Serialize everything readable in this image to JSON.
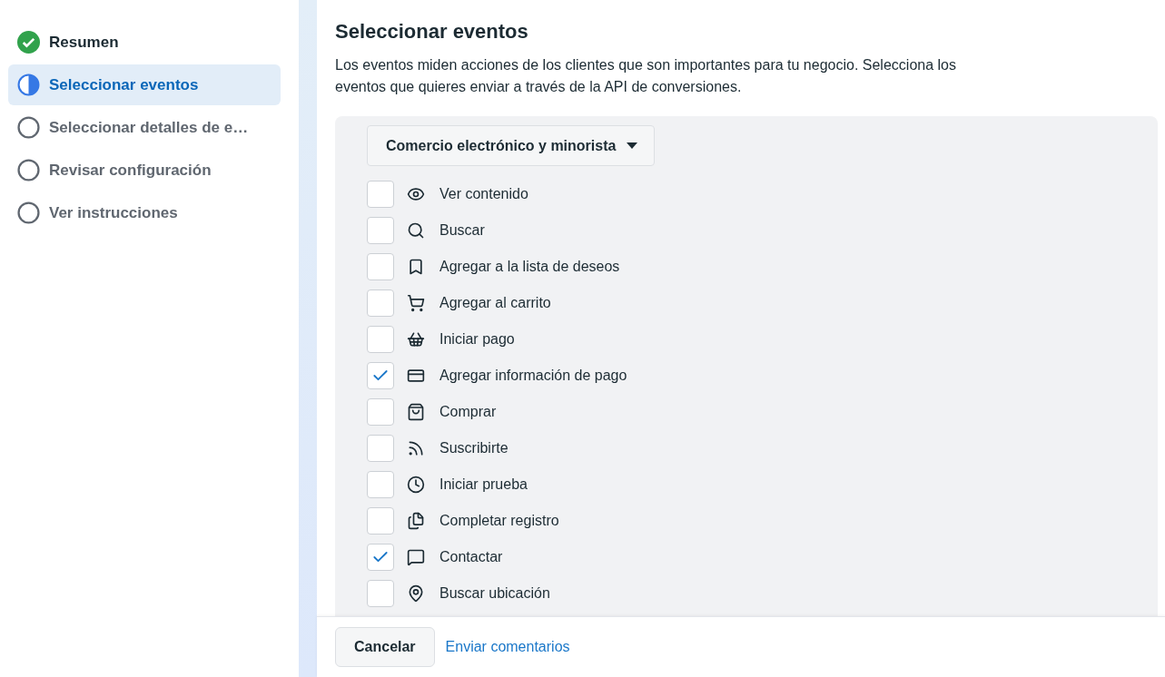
{
  "steps": [
    {
      "label": "Resumen",
      "kind": "complete",
      "selected": false
    },
    {
      "label": "Seleccionar eventos",
      "kind": "current",
      "selected": true
    },
    {
      "label": "Seleccionar detalles de e…",
      "kind": "pending",
      "selected": false
    },
    {
      "label": "Revisar configuración",
      "kind": "pending",
      "selected": false
    },
    {
      "label": "Ver instrucciones",
      "kind": "pending",
      "selected": false
    }
  ],
  "title": "Seleccionar eventos",
  "description": "Los eventos miden acciones de los clientes que son importantes para tu negocio. Selecciona los eventos que quieres enviar a través de la API de conversiones.",
  "category_dropdown": {
    "value": "Comercio electrónico y minorista"
  },
  "events": [
    {
      "label": "Ver contenido",
      "checked": false
    },
    {
      "label": "Buscar",
      "checked": false
    },
    {
      "label": "Agregar a la lista de deseos",
      "checked": false
    },
    {
      "label": "Agregar al carrito",
      "checked": false
    },
    {
      "label": "Iniciar pago",
      "checked": false
    },
    {
      "label": "Agregar información de pago",
      "checked": true
    },
    {
      "label": "Comprar",
      "checked": false
    },
    {
      "label": "Suscribirte",
      "checked": false
    },
    {
      "label": "Iniciar prueba",
      "checked": false
    },
    {
      "label": "Completar registro",
      "checked": false
    },
    {
      "label": "Contactar",
      "checked": true
    },
    {
      "label": "Buscar ubicación",
      "checked": false
    }
  ],
  "footer": {
    "cancel": "Cancelar",
    "feedback_link": "Enviar comentarios"
  }
}
